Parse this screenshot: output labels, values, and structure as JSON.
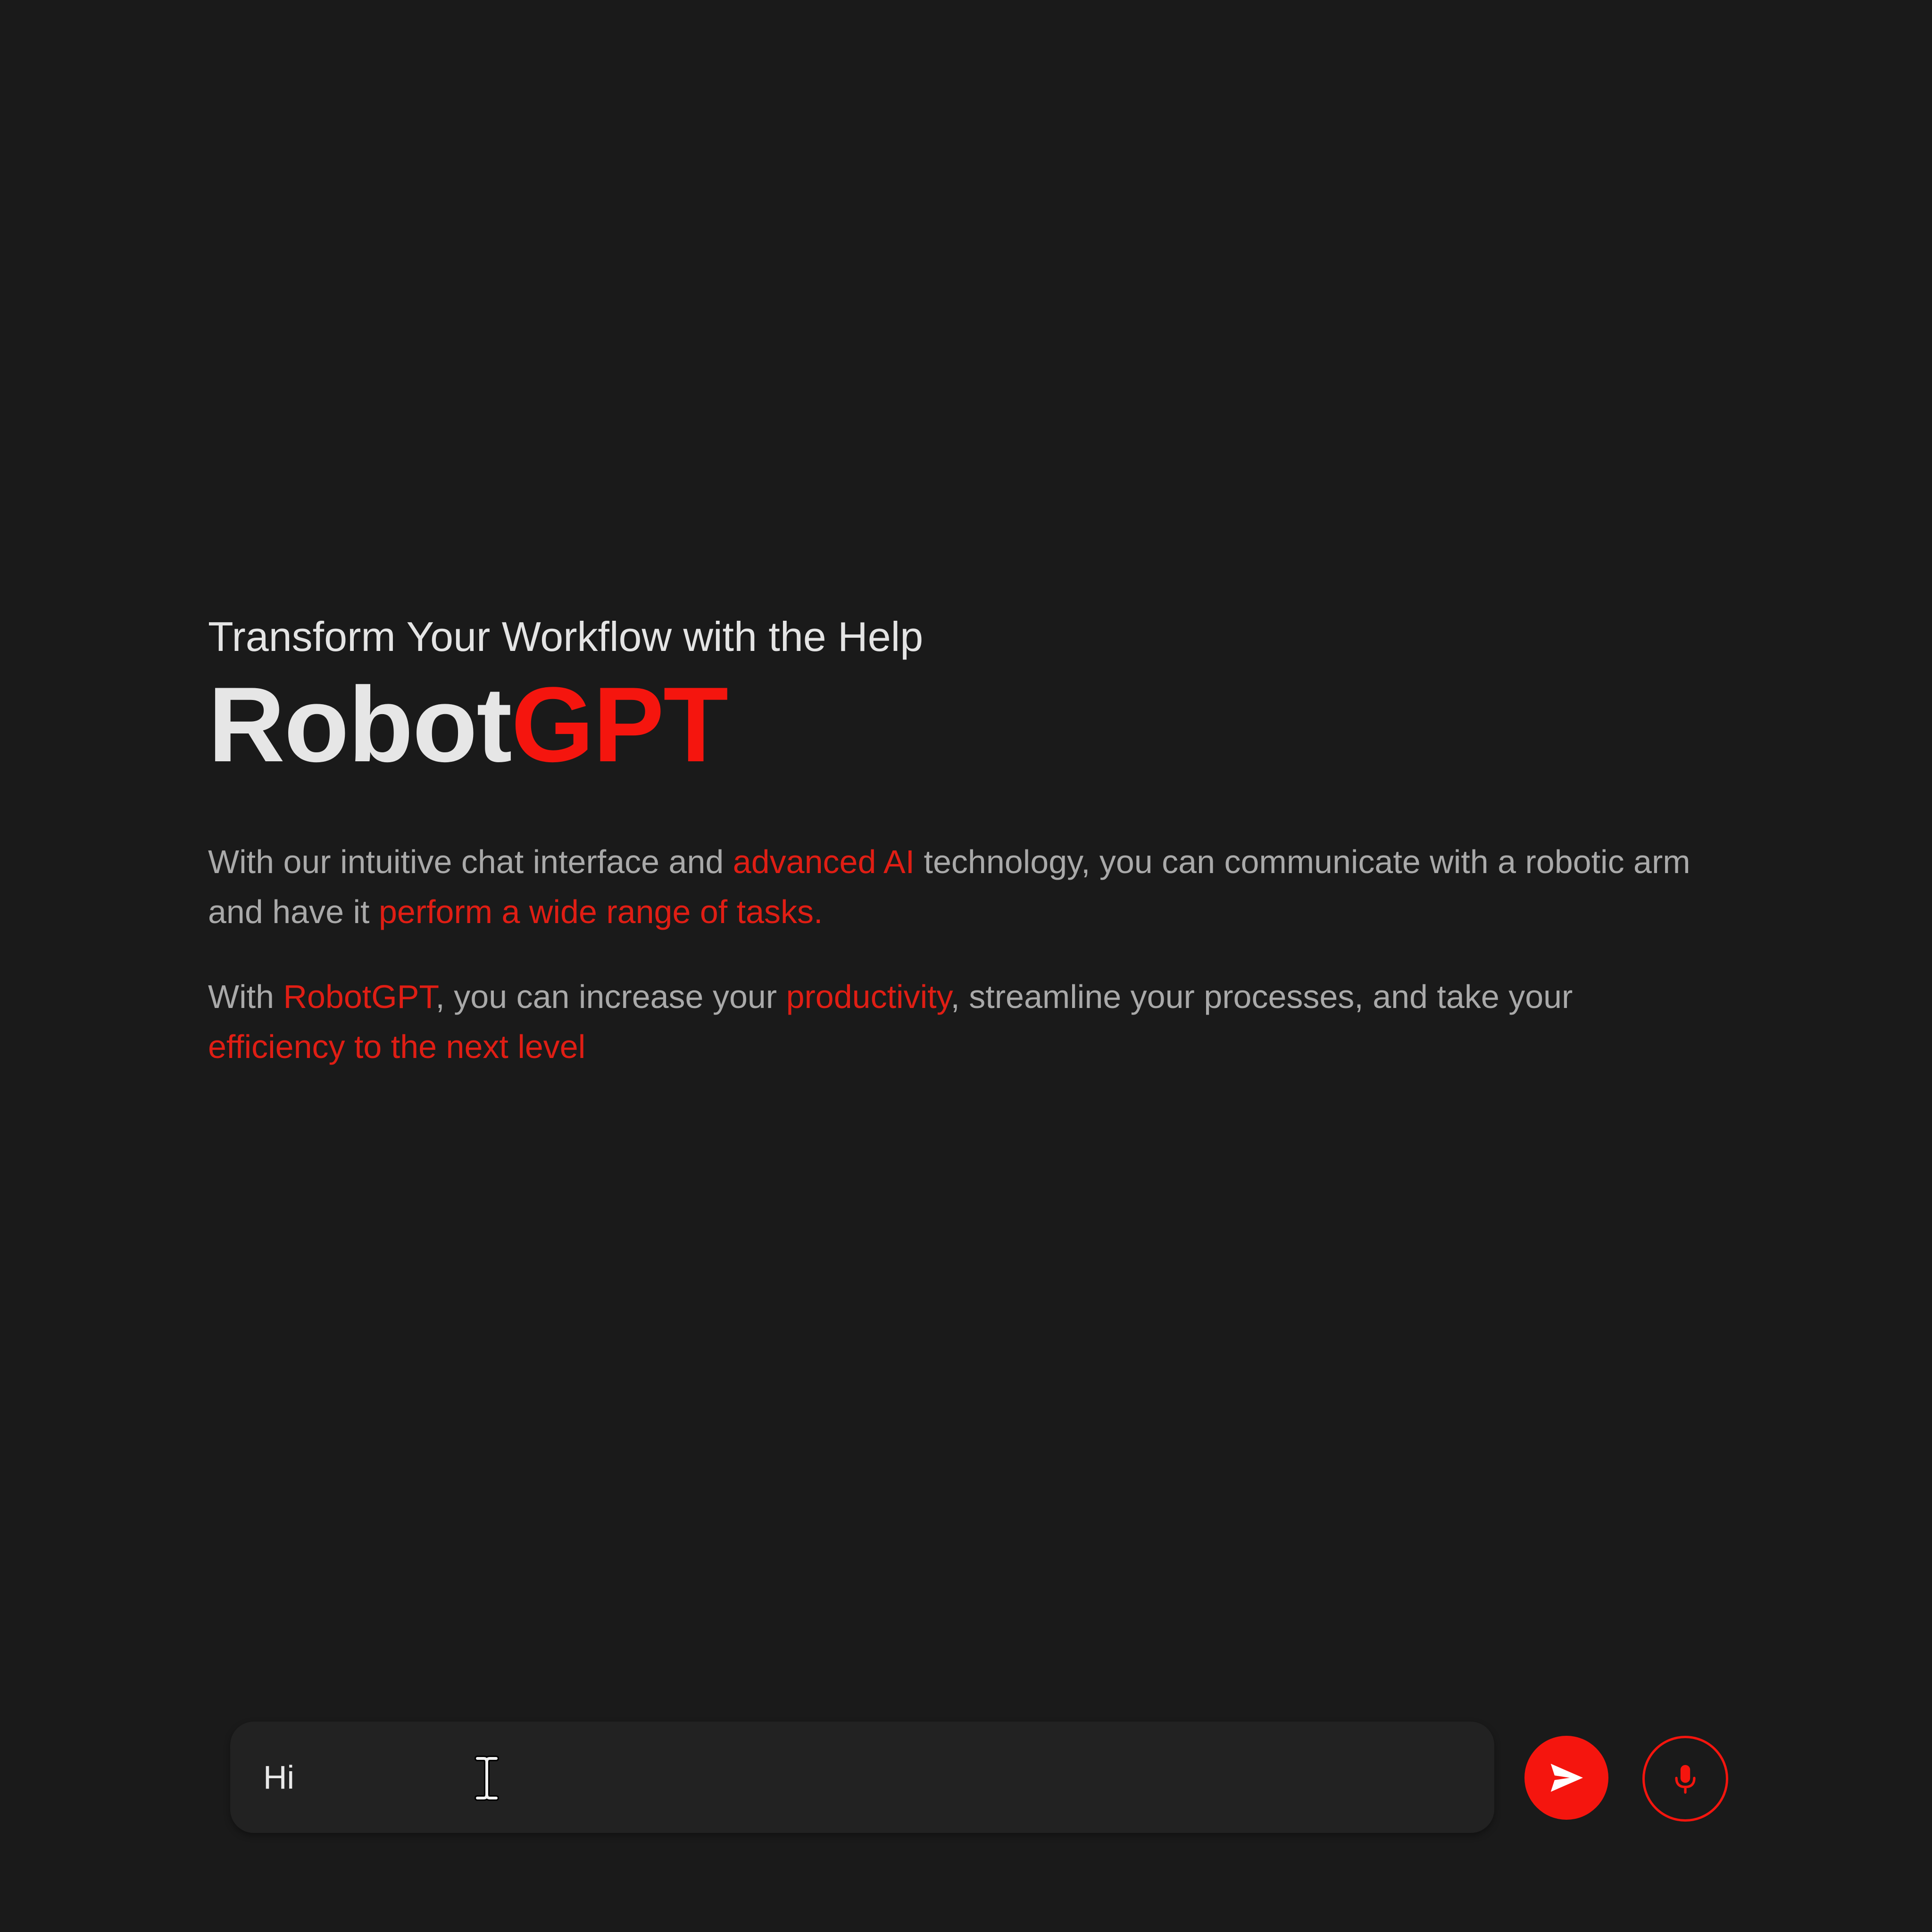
{
  "hero": {
    "subtitle": "Transform Your Workflow with the Help",
    "brand_part1": "Robot",
    "brand_part2": "GPT",
    "paragraph1": [
      {
        "text": "With our intuitive chat interface and ",
        "highlight": false
      },
      {
        "text": "advanced AI",
        "highlight": true
      },
      {
        "text": " technology, you can communicate with a robotic arm and have it ",
        "highlight": false
      },
      {
        "text": "perform a wide range of tasks.",
        "highlight": true
      }
    ],
    "paragraph2": [
      {
        "text": "With ",
        "highlight": false
      },
      {
        "text": "RobotGPT",
        "highlight": true
      },
      {
        "text": ", you can increase your ",
        "highlight": false
      },
      {
        "text": "productivity",
        "highlight": true
      },
      {
        "text": ", streamline your processes, and take your ",
        "highlight": false
      },
      {
        "text": "efficiency to the next level",
        "highlight": true
      }
    ]
  },
  "chat": {
    "input_value": "Hi"
  },
  "icons": {
    "send": "send-icon",
    "mic": "microphone-icon",
    "cursor": "text-cursor-icon"
  },
  "colors": {
    "background": "#1a1a1a",
    "accent": "#f5150e",
    "highlight_text": "#e01e14",
    "body_text": "#a9a9a9",
    "heading_text": "#e6e6e6",
    "input_bg": "#222222"
  }
}
